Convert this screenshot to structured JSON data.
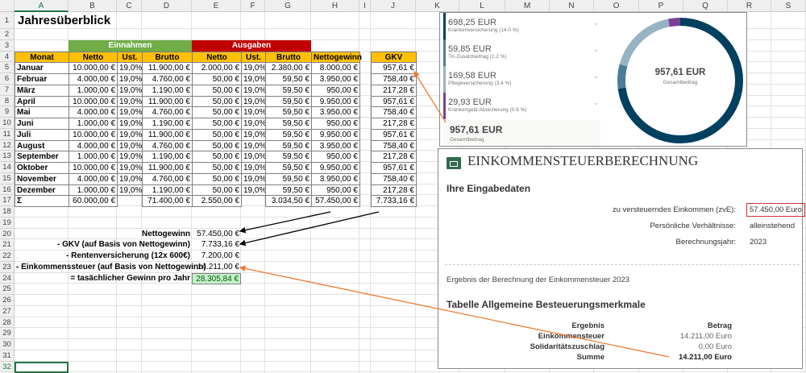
{
  "columns": [
    "A",
    "B",
    "C",
    "D",
    "E",
    "F",
    "G",
    "H",
    "I",
    "J",
    "K",
    "L",
    "M",
    "N",
    "O",
    "P",
    "Q",
    "R",
    "S"
  ],
  "title": "Jahresüberblick",
  "groups": {
    "income": "Einnahmen",
    "expenses": "Ausgaben",
    "income_color": "#70ad47",
    "expenses_color": "#c00000"
  },
  "headers": [
    "Monat",
    "Netto",
    "Ust.",
    "Brutto",
    "Netto",
    "Ust.",
    "Brutto",
    "Nettogewinn",
    "GKV"
  ],
  "rows": [
    [
      "Januar",
      "10.000,00 €",
      "19,0%",
      "11.900,00 €",
      "2.000,00 €",
      "19,0%",
      "2.380,00 €",
      "8.000,00 €",
      "957,61 €"
    ],
    [
      "Februar",
      "4.000,00 €",
      "19,0%",
      "4.760,00 €",
      "50,00 €",
      "19,0%",
      "59,50 €",
      "3.950,00 €",
      "758,40 €"
    ],
    [
      "März",
      "1.000,00 €",
      "19,0%",
      "1.190,00 €",
      "50,00 €",
      "19,0%",
      "59,50 €",
      "950,00 €",
      "217,28 €"
    ],
    [
      "April",
      "10.000,00 €",
      "19,0%",
      "11.900,00 €",
      "50,00 €",
      "19,0%",
      "59,50 €",
      "9.950,00 €",
      "957,61 €"
    ],
    [
      "Mai",
      "4.000,00 €",
      "19,0%",
      "4.760,00 €",
      "50,00 €",
      "19,0%",
      "59,50 €",
      "3.950,00 €",
      "758,40 €"
    ],
    [
      "Juni",
      "1.000,00 €",
      "19,0%",
      "1.190,00 €",
      "50,00 €",
      "19,0%",
      "59,50 €",
      "950,00 €",
      "217,28 €"
    ],
    [
      "Juli",
      "10.000,00 €",
      "19,0%",
      "11.900,00 €",
      "50,00 €",
      "19,0%",
      "59,50 €",
      "9.950,00 €",
      "957,61 €"
    ],
    [
      "August",
      "4.000,00 €",
      "19,0%",
      "4.760,00 €",
      "50,00 €",
      "19,0%",
      "59,50 €",
      "3.950,00 €",
      "758,40 €"
    ],
    [
      "September",
      "1.000,00 €",
      "19,0%",
      "1.190,00 €",
      "50,00 €",
      "19,0%",
      "59,50 €",
      "950,00 €",
      "217,28 €"
    ],
    [
      "Oktober",
      "10.000,00 €",
      "19,0%",
      "11.900,00 €",
      "50,00 €",
      "19,0%",
      "59,50 €",
      "9.950,00 €",
      "957,61 €"
    ],
    [
      "November",
      "4.000,00 €",
      "19,0%",
      "4.760,00 €",
      "50,00 €",
      "19,0%",
      "59,50 €",
      "3.950,00 €",
      "758,40 €"
    ],
    [
      "Dezember",
      "1.000,00 €",
      "19,0%",
      "1.190,00 €",
      "50,00 €",
      "19,0%",
      "59,50 €",
      "950,00 €",
      "217,28 €"
    ]
  ],
  "sum_row": [
    "Σ",
    "60.000,00 €",
    "",
    "71.400,00 €",
    "2.550,00 €",
    "",
    "3.034,50 €",
    "57.450,00 €",
    "7.733,16 €"
  ],
  "summary": [
    {
      "label": "Nettogewinn",
      "value": "57.450,00 €"
    },
    {
      "label": "- GKV (auf Basis von Nettogewinn)",
      "value": "7.733,16 €"
    },
    {
      "label": "- Rentenversicherung (12x 600€)",
      "value": "7.200,00 €"
    },
    {
      "label": "- Einkommenssteuer (auf Basis von Nettogewinn)",
      "value": "14.211,00 €"
    },
    {
      "label": "= tasächlicher Gewinn pro Jahr",
      "value": "28.305,84 €"
    }
  ],
  "gkv_panel": {
    "items": [
      {
        "amount": "698,25 EUR",
        "label": "Krankenversicherung (14.0 %)",
        "value": 698.25,
        "color": "#00405f"
      },
      {
        "amount": "59,85 EUR",
        "label": "TK-Zusatzbeitrag (1.2 %)",
        "value": 59.85,
        "color": "#4a7d98"
      },
      {
        "amount": "169,58 EUR",
        "label": "Pflegeversicherung (3.4 %)",
        "value": 169.58,
        "color": "#98b4c4"
      },
      {
        "amount": "29,93 EUR",
        "label": "Krankengeld-Absicherung (0.6 %)",
        "value": 29.93,
        "color": "#7b3f98"
      }
    ],
    "total_amount": "957,61 EUR",
    "total_label": "Gesamtbeitrag"
  },
  "tax_panel": {
    "title": "EINKOMMENSTEUERBERECHNUNG",
    "inputs_heading": "Ihre Eingabedaten",
    "inputs": [
      {
        "label": "zu versteuerndes Einkommen (zvE):",
        "value": "57.450,00 Euro"
      },
      {
        "label": "Persönliche Verhältnisse:",
        "value": "alleinstehend"
      },
      {
        "label": "Berechnungsjahr:",
        "value": "2023"
      }
    ],
    "result_text": "Ergebnis der Berechnung der Einkommensteuer 2023",
    "table_heading": "Tabelle Allgemeine Besteuerungsmerkmale",
    "table_headers": [
      "Ergebnis",
      "Betrag"
    ],
    "table_rows": [
      {
        "label": "Einkommensteuer",
        "value": "14.211,00 Euro"
      },
      {
        "label": "Solidaritätszuschlag",
        "value": "0,00 Euro"
      },
      {
        "label": "Summe",
        "value": "14.211,00 Euro"
      }
    ]
  }
}
